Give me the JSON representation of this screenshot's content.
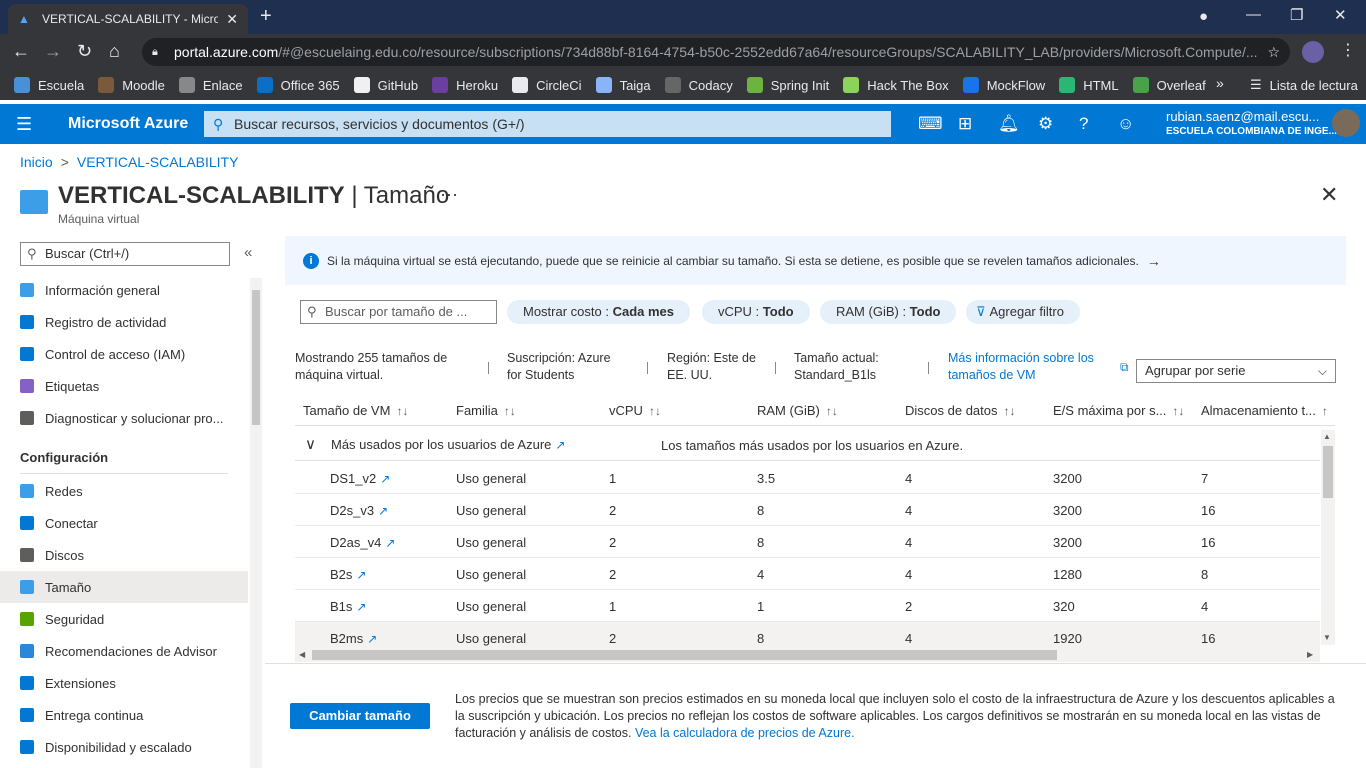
{
  "browser": {
    "tab_title": "VERTICAL-SCALABILITY - Microso",
    "url_host": "portal.azure.com",
    "url_path": "/#@escuelaing.edu.co/resource/subscriptions/734d88bf-8164-4754-b50c-2552edd67a64/resourceGroups/SCALABILITY_LAB/providers/Microsoft.Compute/...",
    "bookmarks": [
      "Escuela",
      "Moodle",
      "Enlace",
      "Office 365",
      "GitHub",
      "Heroku",
      "CircleCi",
      "Taiga",
      "Codacy",
      "Spring Init",
      "Hack The Box",
      "MockFlow",
      "HTML",
      "Overleaf"
    ],
    "reading_list": "Lista de lectura"
  },
  "azure": {
    "brand": "Microsoft Azure",
    "search_placeholder": "Buscar recursos, servicios y documentos (G+/)",
    "user_email": "rubian.saenz@mail.escu...",
    "user_org": "ESCUELA COLOMBIANA DE INGE..."
  },
  "breadcrumb": {
    "home": "Inicio",
    "current": "VERTICAL-SCALABILITY"
  },
  "page": {
    "title_resource": "VERTICAL-SCALABILITY",
    "title_sep": " | ",
    "title_section": "Tamaño",
    "subtitle": "Máquina virtual"
  },
  "sidebar": {
    "search_placeholder": "Buscar (Ctrl+/)",
    "items_top": [
      "Información general",
      "Registro de actividad",
      "Control de acceso (IAM)",
      "Etiquetas",
      "Diagnosticar y solucionar pro..."
    ],
    "section": "Configuración",
    "items_config": [
      "Redes",
      "Conectar",
      "Discos",
      "Tamaño",
      "Seguridad",
      "Recomendaciones de Advisor",
      "Extensiones",
      "Entrega continua",
      "Disponibilidad y escalado"
    ]
  },
  "main": {
    "info": "Si la máquina virtual se está ejecutando, puede que se reinicie al cambiar su tamaño. Si esta se detiene, es posible que se revelen tamaños adicionales.",
    "size_search_placeholder": "Buscar por tamaño de ...",
    "filters": [
      {
        "label": "Mostrar costo : ",
        "value": "Cada mes"
      },
      {
        "label": "vCPU : ",
        "value": "Todo"
      },
      {
        "label": "RAM (GiB) : ",
        "value": "Todo"
      }
    ],
    "add_filter": "Agregar filtro",
    "summary": {
      "showing_l1": "Mostrando 255 tamaños de",
      "showing_l2": "máquina virtual.",
      "sub_l1": "Suscripción: Azure",
      "sub_l2": "for Students",
      "region_l1": "Región: Este de",
      "region_l2": "EE. UU.",
      "current_l1": "Tamaño actual:",
      "current_l2": "Standard_B1ls",
      "more_l1": "Más información sobre los",
      "more_l2": "tamaños de VM"
    },
    "group_by": "Agrupar por serie",
    "columns": [
      "Tamaño de VM",
      "Familia",
      "vCPU",
      "RAM (GiB)",
      "Discos de datos",
      "E/S máxima por s...",
      "Almacenamiento t..."
    ],
    "group_name": "Más usados por los usuarios de Azure",
    "group_desc": "Los tamaños más usados por los usuarios en Azure.",
    "rows": [
      {
        "size": "DS1_v2",
        "family": "Uso general",
        "vcpu": "1",
        "ram": "3.5",
        "disks": "4",
        "iops": "3200",
        "storage": "7"
      },
      {
        "size": "D2s_v3",
        "family": "Uso general",
        "vcpu": "2",
        "ram": "8",
        "disks": "4",
        "iops": "3200",
        "storage": "16"
      },
      {
        "size": "D2as_v4",
        "family": "Uso general",
        "vcpu": "2",
        "ram": "8",
        "disks": "4",
        "iops": "3200",
        "storage": "16"
      },
      {
        "size": "B2s",
        "family": "Uso general",
        "vcpu": "2",
        "ram": "4",
        "disks": "4",
        "iops": "1280",
        "storage": "8"
      },
      {
        "size": "B1s",
        "family": "Uso general",
        "vcpu": "1",
        "ram": "1",
        "disks": "2",
        "iops": "320",
        "storage": "4"
      },
      {
        "size": "B2ms",
        "family": "Uso general",
        "vcpu": "2",
        "ram": "8",
        "disks": "4",
        "iops": "1920",
        "storage": "16"
      }
    ],
    "resize_button": "Cambiar tamaño",
    "note": "Los precios que se muestran son precios estimados en su moneda local que incluyen solo el costo de la infraestructura de Azure y los descuentos aplicables a la suscripción y ubicación. Los precios no reflejan los costos de software aplicables. Los cargos definitivos se mostrarán en su moneda local en las vistas de facturación y análisis de costos. ",
    "note_link": "Vea la calculadora de precios de Azure."
  },
  "colors": {
    "azure_blue": "#0078d4",
    "browser_dark": "#35363a",
    "title_bar": "#1f2f4f"
  }
}
